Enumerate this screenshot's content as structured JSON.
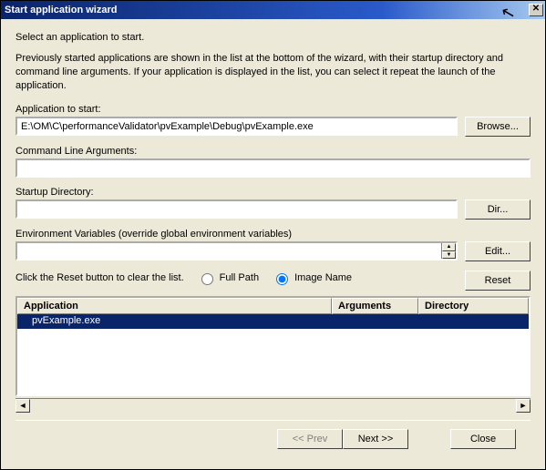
{
  "window": {
    "title": "Start application wizard"
  },
  "intro": "Select an application to start.",
  "description": "Previously started applications are shown in the list at the bottom of the wizard, with their startup directory and command line arguments. If your application is displayed in the list, you can select it repeat the launch of the application.",
  "fields": {
    "app_label": "Application to start:",
    "app_value": "E:\\OM\\C\\performanceValidator\\pvExample\\Debug\\pvExample.exe",
    "browse": "Browse...",
    "cmd_label": "Command Line Arguments:",
    "cmd_value": "",
    "startup_label": "Startup Directory:",
    "startup_value": "",
    "dir_btn": "Dir...",
    "env_label": "Environment Variables (override global environment variables)",
    "env_value": "",
    "edit_btn": "Edit...",
    "reset_btn": "Reset"
  },
  "listline": {
    "text": "Click the Reset button to clear the list.",
    "radio_fullpath": "Full Path",
    "radio_imagename": "Image Name"
  },
  "table": {
    "cols": {
      "app": "Application",
      "arg": "Arguments",
      "dir": "Directory"
    },
    "rows": [
      {
        "app": "pvExample.exe",
        "arg": "",
        "dir": ""
      }
    ]
  },
  "footer": {
    "prev": "<< Prev",
    "next": "Next >>",
    "close": "Close"
  }
}
